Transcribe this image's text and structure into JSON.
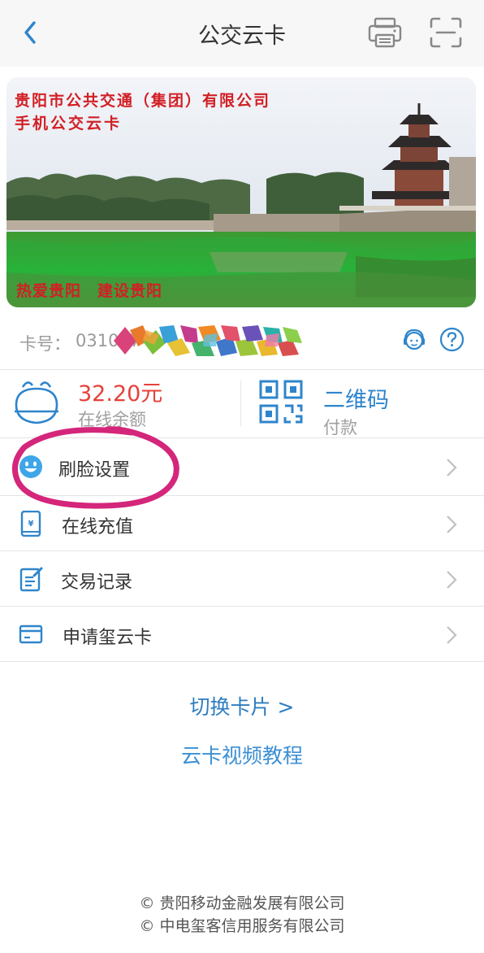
{
  "header": {
    "title": "公交云卡"
  },
  "card": {
    "company": "贵阳市公共交通（集团）有限公司",
    "name": "手机公交云卡",
    "slogan": "热爱贵阳　建设贵阳"
  },
  "card_number": {
    "label": "卡号：",
    "value": "03104740"
  },
  "balance": {
    "amount": "32.20元",
    "label": "在线余额"
  },
  "qr": {
    "label": "二维码",
    "sub": "付款"
  },
  "menu": [
    {
      "label": "刷脸设置",
      "icon": "smiley-face-icon"
    },
    {
      "label": "在线充值",
      "icon": "phone-recharge-icon"
    },
    {
      "label": "交易记录",
      "icon": "record-document-icon"
    },
    {
      "label": "申请玺云卡",
      "icon": "card-icon"
    }
  ],
  "links": {
    "switch_card": "切换卡片 >",
    "video_tutorial": "云卡视频教程"
  },
  "footer": {
    "line1": "© 贵阳移动金融发展有限公司",
    "line2": "© 中电玺客信用服务有限公司"
  },
  "colors": {
    "accent": "#2e85cc",
    "balance": "#e5413a",
    "highlight": "#d4267a"
  }
}
